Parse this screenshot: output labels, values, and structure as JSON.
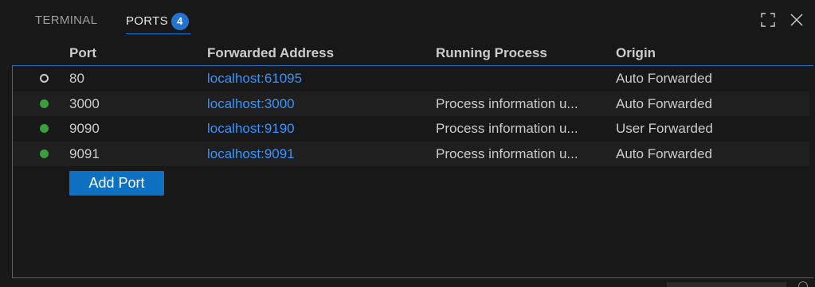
{
  "tabs": [
    {
      "label": "TERMINAL",
      "active": false
    },
    {
      "label": "PORTS",
      "active": true,
      "badge": "4"
    }
  ],
  "actions": {
    "maximize_icon": "maximize-icon",
    "close_icon": "close-icon"
  },
  "table": {
    "columns": [
      "Port",
      "Forwarded Address",
      "Running Process",
      "Origin"
    ],
    "rows": [
      {
        "status": "inactive",
        "port": "80",
        "address": "localhost:61095",
        "process": "",
        "origin": "Auto Forwarded"
      },
      {
        "status": "active",
        "port": "3000",
        "address": "localhost:3000",
        "process": "Process information u...",
        "origin": "Auto Forwarded"
      },
      {
        "status": "active",
        "port": "9090",
        "address": "localhost:9190",
        "process": "Process information u...",
        "origin": "User Forwarded"
      },
      {
        "status": "active",
        "port": "9091",
        "address": "localhost:9091",
        "process": "Process information u...",
        "origin": "Auto Forwarded"
      }
    ]
  },
  "add_port_label": "Add Port",
  "colors": {
    "accent": "#0078d4",
    "badge": "#2374d0",
    "link": "#3794ff",
    "active_status": "#379f3c",
    "button": "#0e70c0"
  }
}
